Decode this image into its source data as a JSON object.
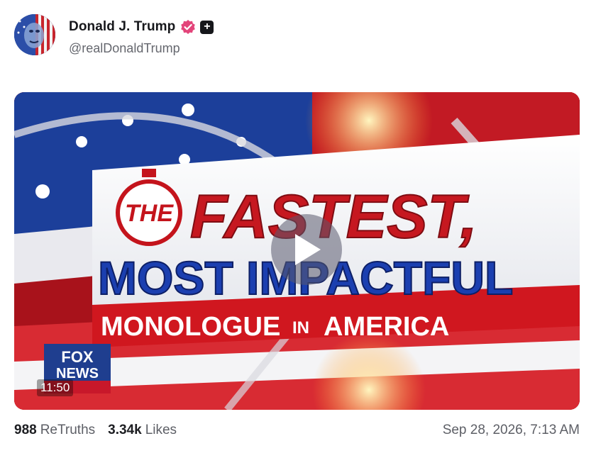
{
  "author": {
    "display_name": "Donald J. Trump",
    "handle": "@realDonaldTrump",
    "avatar_icon": "avatar-image",
    "verified_color": "#e3447a"
  },
  "media": {
    "type": "video",
    "title_line1_a": "THE",
    "title_line1_b": "FASTEST,",
    "title_line2": "MOST IMPACTFUL",
    "title_line3_a": "MONOLOGUE",
    "title_line3_b": "IN",
    "title_line3_c": "AMERICA",
    "duration": "11:50",
    "network_logo": "FOX NEWS"
  },
  "stats": {
    "retruths_count": "988",
    "retruths_label": "ReTruths",
    "likes_count": "3.34k",
    "likes_label": "Likes",
    "timestamp": "Sep 28, 2026, 7:13 AM"
  }
}
